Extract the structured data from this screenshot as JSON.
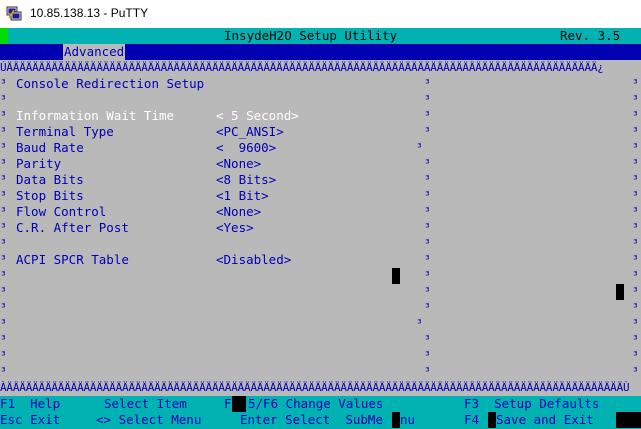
{
  "window": {
    "title": "10.85.138.13 - PuTTY",
    "icon": "putty-icon"
  },
  "bios": {
    "title": "InsydeH2O Setup Utility",
    "revision": "Rev. 3.5",
    "active_tab": "Advanced",
    "border_top": "ÚÄÄÄÄÄÄÄÄÄÄÄÄÄÄÄÄÄÄÄÄÄÄÄÄÄÄÄÄÄÄÄÄÄÄÄÄÄÄÄÄÄÄÄÄÄÄÄÄÄÄÄÄÄÄÄÄÄÄÄÄÄÄÄÄÄÄÄÄÄÄÄÄÄÄÄÄÄÄÄÄÄÄÄÄÄÄÄÄÄÄÄÄ¿",
    "border_bottom": "ÀÄÄÄÄÄÄÄÄÄÄÄÄÄÄÄÄÄÄÄÄÄÄÄÄÄÄÄÄÄÄÄÄÄÄÄÄÄÄÄÄÄÄÄÄÄÄÄÄÄÄÄÄÄÄÄÄÄÄÄÄÄÄÄÄÄÄÄÄÄÄÄÄÄÄÄÄÄÄÄÄÄÄÄÄÄÄÄÄÄÄÄÄÄÄÄÄÙ",
    "edge_char": "³",
    "section_title": "Console Redirection Setup"
  },
  "settings": [
    {
      "label": "Information Wait Time",
      "value": "< 5 Second>",
      "selected": true
    },
    {
      "label": "Terminal Type",
      "value": "<PC_ANSI>"
    },
    {
      "label": "Baud Rate",
      "value": "<  9600>"
    },
    {
      "label": "Parity",
      "value": "<None>"
    },
    {
      "label": "Data Bits",
      "value": "<8 Bits>"
    },
    {
      "label": "Stop Bits",
      "value": "<1 Bit>"
    },
    {
      "label": "Flow Control",
      "value": "<None>"
    },
    {
      "label": "C.R. After Post",
      "value": "<Yes>"
    },
    {
      "label": "ACPI SPCR Table",
      "value": "<Disabled>"
    }
  ],
  "footer": {
    "f1": "F1  Help",
    "select_item": "Select Item",
    "f5_prefix": "F",
    "f5f6": "5/F6 Change Values",
    "f3": "F3  Setup Defaults",
    "esc": "Esc Exit",
    "select_menu": "<> Select Menu",
    "enter": "Enter Select  SubMe",
    "enter_tail": "nu",
    "f4": "F4",
    "save_exit": "Save and Exit"
  }
}
